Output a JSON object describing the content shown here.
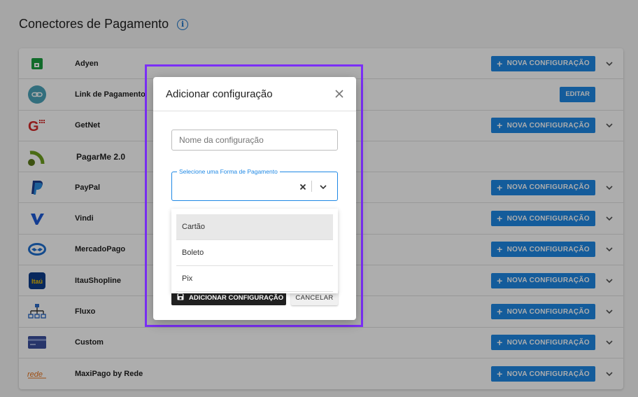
{
  "page": {
    "title": "Conectores de Pagamento",
    "info_icon": "info-icon"
  },
  "connectors": [
    {
      "name": "Adyen",
      "icon": "adyen-logo",
      "action": "NOVA CONFIGURAÇÃO",
      "expandable": true
    },
    {
      "name": "Link de Pagamento",
      "icon": "link-logo",
      "action": "EDITAR",
      "expandable": false
    },
    {
      "name": "GetNet",
      "icon": "getnet-logo",
      "action": "NOVA CONFIGURAÇÃO",
      "expandable": true
    },
    {
      "name": "PagarMe 2.0",
      "icon": "pagarme-logo",
      "action": "",
      "expandable": false
    },
    {
      "name": "PayPal",
      "icon": "paypal-logo",
      "action": "NOVA CONFIGURAÇÃO",
      "expandable": true
    },
    {
      "name": "Vindi",
      "icon": "vindi-logo",
      "action": "NOVA CONFIGURAÇÃO",
      "expandable": true
    },
    {
      "name": "MercadoPago",
      "icon": "mercadopago-logo",
      "action": "NOVA CONFIGURAÇÃO",
      "expandable": true
    },
    {
      "name": "ItauShopline",
      "icon": "itau-logo",
      "action": "NOVA CONFIGURAÇÃO",
      "expandable": true
    },
    {
      "name": "Fluxo",
      "icon": "fluxo-logo",
      "action": "NOVA CONFIGURAÇÃO",
      "expandable": true
    },
    {
      "name": "Custom",
      "icon": "card-logo",
      "action": "NOVA CONFIGURAÇÃO",
      "expandable": true
    },
    {
      "name": "MaxiPago by Rede",
      "icon": "rede-logo",
      "action": "NOVA CONFIGURAÇÃO",
      "expandable": true
    }
  ],
  "modal": {
    "title": "Adicionar configuração",
    "name_placeholder": "Nome da configuração",
    "name_value": "",
    "select_label": "Selecione uma Forma de Pagamento",
    "select_value": "",
    "options": [
      "Cartão",
      "Boleto",
      "Pix"
    ],
    "active_option": "Cartão",
    "add_button": "ADICIONAR CONFIGURAÇÃO",
    "cancel_button": "CANCELAR"
  },
  "colors": {
    "primary": "#1e88e5",
    "highlight": "#7b2ff7",
    "dark_button": "#212121"
  }
}
